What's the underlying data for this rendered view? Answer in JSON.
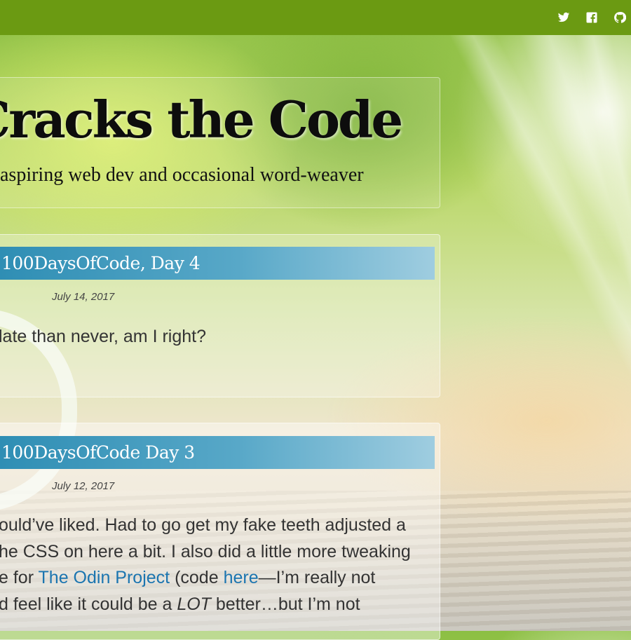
{
  "site": {
    "title": "Cracks the Code",
    "tagline": "aspiring web dev and occasional word-weaver"
  },
  "nav": {
    "icons": [
      "twitter-icon",
      "facebook-icon",
      "github-icon"
    ],
    "color": "#6b9a12"
  },
  "posts": [
    {
      "title": "100DaysOfCode, Day 4",
      "date": "July 14, 2017",
      "excerpt": "late than never, am I right?"
    },
    {
      "title": "100DaysOfCode Day 3",
      "date": "July 12, 2017",
      "excerpt_lines": {
        "l1": "ould’ve liked. Had to go get my fake teeth adjusted a",
        "l2": "he CSS on here a bit. I also did a little more tweaking",
        "l3_before": "e for ",
        "l3_link1": "The Odin Project",
        "l3_mid": " (code ",
        "l3_link2": "here",
        "l3_after": "—I’m really not",
        "l4_before": "d feel like it could be a ",
        "l4_em": "LOT",
        "l4_after": " better…but I’m not"
      }
    }
  ],
  "colors": {
    "title_bar": "#2f8eb4",
    "link": "#1b75b0"
  }
}
